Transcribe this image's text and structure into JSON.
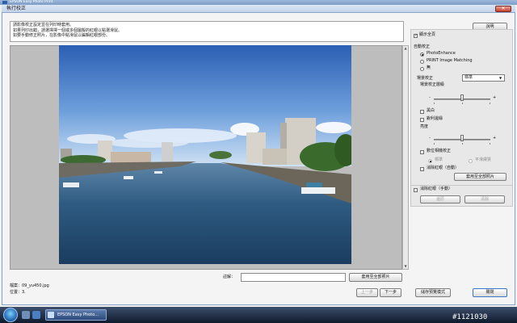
{
  "app": {
    "title": "EPSON Easy Photo Print"
  },
  "dialog": {
    "title": "執行校正",
    "close_glyph": "✕"
  },
  "instructions": [
    "請影像校正設定並在列印時套用。",
    "如果列印出錯，請選擇擇一個或多個圖擬的紅眼以點選滑鼠。",
    "如要手動修正照片，在影像中點滑鼠以編輯紅眼部份。"
  ],
  "preview": {
    "comment_label": "註解：",
    "comment_value": "",
    "apply_all_comment": "套用至全部照片",
    "filename": "檔案：09_yu450.jpg",
    "position": "位置：3.",
    "prev": "上一步",
    "next": "下一步"
  },
  "right_panel": {
    "help": "說明",
    "show_all": {
      "label": "顯示全頁",
      "checked": true
    },
    "auto_correct_label": "自動校正",
    "modes": [
      {
        "label": "PhotoEnhance",
        "selected": true
      },
      {
        "label": "PRINT Image Matching",
        "selected": false
      },
      {
        "label": "無",
        "selected": false
      }
    ],
    "scene_label": "場景校正",
    "scene_value": "標準",
    "scene_level_label": "場景校正層級",
    "scene_level_value": 0.5,
    "slider_minus": "-",
    "slider_plus": "+",
    "bw": {
      "label": "黑白",
      "checked": false
    },
    "sharpen": {
      "label": "銳利邊緣",
      "checked": false
    },
    "brightness_label": "亮度",
    "brightness_value": 0.5,
    "digital_camera": {
      "label": "數位相機校正",
      "checked": false
    },
    "dc_options": [
      {
        "label": "標準",
        "selected": true
      },
      {
        "label": "平滑膚質",
        "selected": false
      }
    ],
    "red_eye_auto": {
      "label": "消除紅眼（自動）",
      "checked": false
    },
    "apply_all_photos": "套用至全部照片",
    "red_eye_manual": {
      "label": "消除紅眼（手動）",
      "checked": false
    },
    "restore": "還原",
    "clear": "清除",
    "save_settings": "儲存預覽模式",
    "close": "關閉"
  },
  "taskbar": {
    "task_label": "EPSON Easy Photo...",
    "tray_text": "#1121030"
  },
  "colors": {
    "accent": "#3a77c8",
    "titlebar": "#7d9ec8",
    "taskbar": "#0f1a2c"
  }
}
